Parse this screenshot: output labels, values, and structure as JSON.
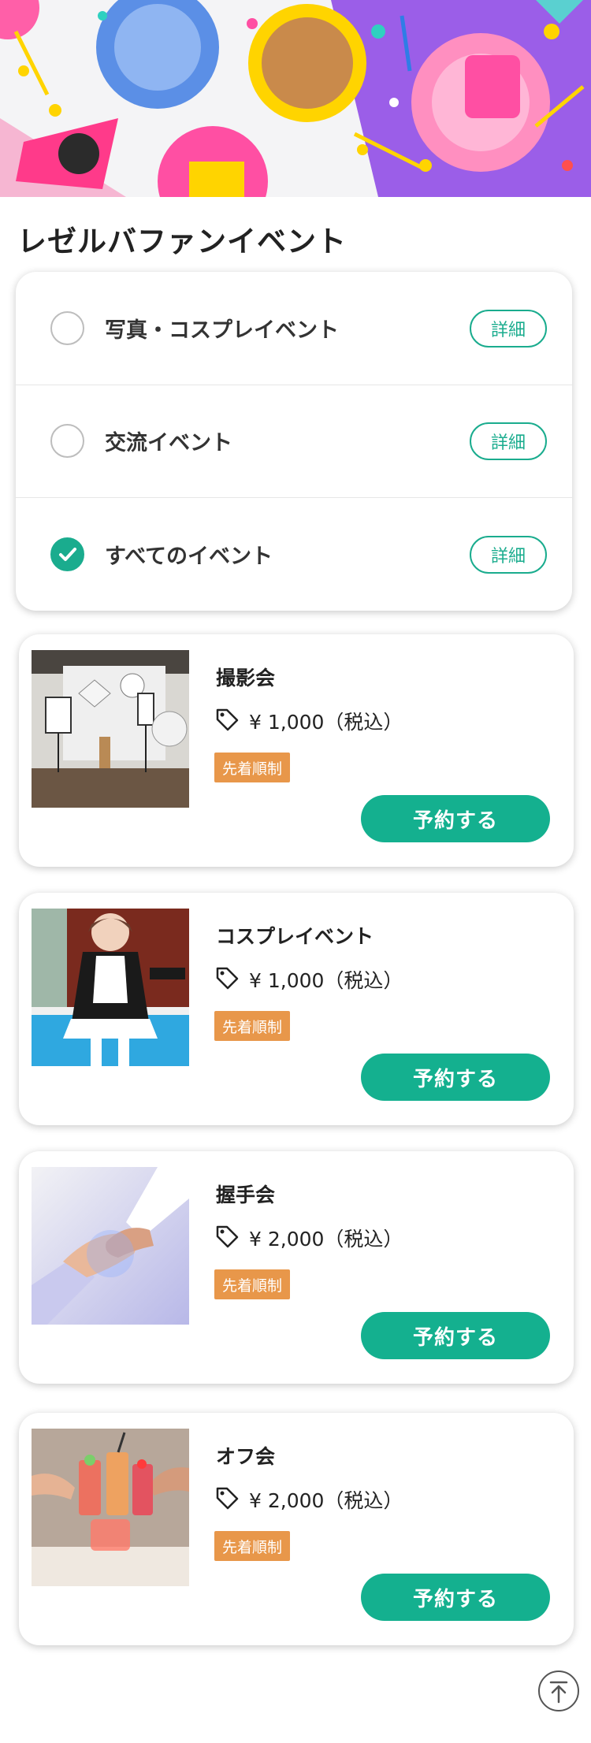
{
  "page": {
    "title": "レゼルバファンイベント"
  },
  "filters": [
    {
      "label": "写真・コスプレイベント",
      "checked": false,
      "detail_label": "詳細"
    },
    {
      "label": "交流イベント",
      "checked": false,
      "detail_label": "詳細"
    },
    {
      "label": "すべてのイベント",
      "checked": true,
      "detail_label": "詳細"
    }
  ],
  "events": [
    {
      "name": "撮影会",
      "price": "¥ 1,000（税込）",
      "badge": "先着順制",
      "button": "予約する",
      "thumb": "photo-studio"
    },
    {
      "name": "コスプレイベント",
      "price": "¥ 1,000（税込）",
      "badge": "先着順制",
      "button": "予約する",
      "thumb": "maid-cosplay"
    },
    {
      "name": "握手会",
      "price": "¥ 2,000（税込）",
      "badge": "先着順制",
      "button": "予約する",
      "thumb": "handshake"
    },
    {
      "name": "オフ会",
      "price": "¥ 2,000（税込）",
      "badge": "先着順制",
      "button": "予約する",
      "thumb": "drinks-toast"
    }
  ],
  "colors": {
    "accent": "#14b08f",
    "badge": "#e8974a",
    "text": "#222222"
  },
  "icons": {
    "price": "tag-icon",
    "checked": "check-icon",
    "back_to_top": "arrow-up-icon"
  }
}
